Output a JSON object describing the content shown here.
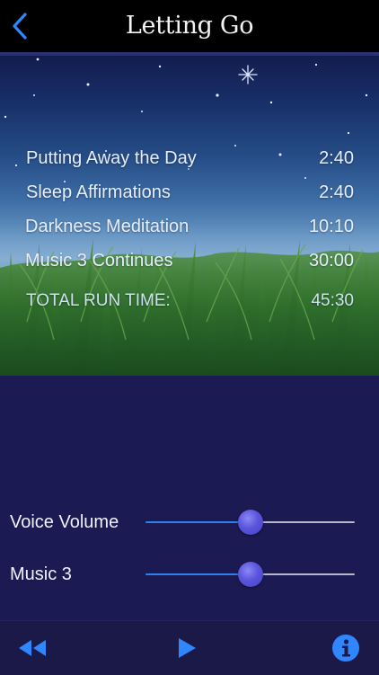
{
  "nav": {
    "title": "Letting Go",
    "back_icon": "chevron-left-icon"
  },
  "tracks": [
    {
      "title": "Putting Away the Day",
      "time": "2:40"
    },
    {
      "title": "Sleep Affirmations",
      "time": "2:40"
    },
    {
      "title": "Darkness Meditation",
      "time": "10:10"
    },
    {
      "title": "Music 3 Continues",
      "time": "30:00"
    }
  ],
  "total": {
    "label": "TOTAL RUN TIME:",
    "time": "45:30"
  },
  "sliders": [
    {
      "label": "Voice Volume",
      "value": 0.5
    },
    {
      "label": "Music 3",
      "value": 0.5
    }
  ],
  "toolbar": {
    "rewind_icon": "rewind-icon",
    "play_icon": "play-icon",
    "info_icon": "info-icon"
  },
  "colors": {
    "accent": "#2f7ff0",
    "background": "#1c1a52",
    "nav_bar": "#000000",
    "thumb": "#5b55dd"
  }
}
